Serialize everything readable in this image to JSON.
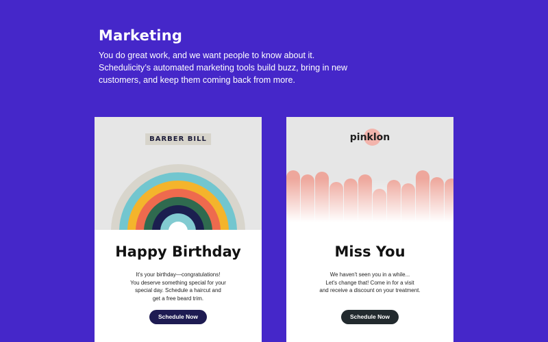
{
  "section": {
    "title": "Marketing",
    "description": "You do great work, and we want people to know about it. Schedulicity’s automated marketing tools build buzz, bring in new customers, and keep them coming back from more."
  },
  "cards": [
    {
      "brand": "BARBER BILL",
      "headline": "Happy Birthday",
      "message": "It's your birthday—congratulations!\nYou deserve something special for your\nspecial day. Schedule a haircut and\nget a free beard trim.",
      "button": "Schedule Now",
      "accent": "#1e1b52",
      "rainbow_colors": [
        "#d8d5cc",
        "#72c6cf",
        "#f4b42c",
        "#ee6a4e",
        "#2f6a4f",
        "#1b1f4f",
        "#82cbd1",
        "#ffffff"
      ]
    },
    {
      "brand": "pinklon",
      "headline": "Miss You",
      "message": "We haven't seen you in a while...\nLet's change that! Come in for a visit\nand receive a discount on your treatment.",
      "button": "Schedule Now",
      "accent": "#222a2e",
      "bar_color": "#eea79c"
    }
  ],
  "colors": {
    "background": "#4527c9"
  }
}
